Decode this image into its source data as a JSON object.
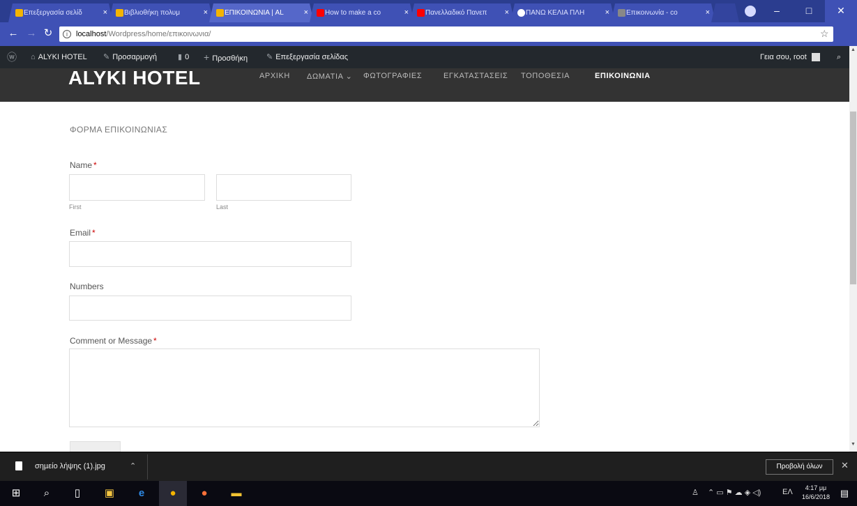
{
  "browser": {
    "tabs": [
      {
        "label": "Επεξεργασία σελίδ",
        "favicon": "#f4b400"
      },
      {
        "label": "Βιβλιοθήκη πολυμ",
        "favicon": "#f4b400"
      },
      {
        "label": "ΕΠΙΚΟΙΝΩΝΙΑ | AL",
        "favicon": "#f4b400",
        "active": true
      },
      {
        "label": "How to make a co",
        "favicon": "#ff0000"
      },
      {
        "label": "Πανελλαδικό Πανεπ",
        "favicon": "#ff0000"
      },
      {
        "label": "ΠΑΝΩ ΚΕΛΙΑ ΠΛΗ",
        "favicon": "#ffffff"
      },
      {
        "label": "Επικοινωνία - co",
        "favicon": "#888888"
      }
    ],
    "url": "localhost/Wordpress/home/επικοινωνια/",
    "url_host": "localhost",
    "url_path": "/Wordpress/home/επικοινωνια/",
    "tab_close": "×",
    "window_controls": {
      "minimize": "–",
      "maximize": "□",
      "close": "✕"
    }
  },
  "adminbar": {
    "site_name": "ALYKI HOTEL",
    "customize": "Προσαρμογή",
    "comments_count": "0",
    "new": "Προσθήκη",
    "edit_page": "Επεξεργασία σελίδας",
    "greeting": "Γεια σου, root"
  },
  "site": {
    "title": "ALYKI HOTEL",
    "menu": [
      "ΑΡΧΙΚΗ",
      "ΔΩΜΑΤΙΑ ⌄",
      "ΦΩΤΟΓΡΑΦΙΕΣ",
      "ΕΓΚΑΤΑΣΤΑΣΕΙΣ",
      "ΤΟΠΟΘΕΣΙΑ",
      "ΕΠΙΚΟΙΝΩΝΙΑ"
    ],
    "current_menu": "ΕΠΙΚΟΙΝΩΝΙΑ"
  },
  "form": {
    "title": "ΦΟΡΜΑ ΕΠΙΚΟΙΝΩΝΙΑΣ",
    "name_label": "Name",
    "first_sublabel": "First",
    "last_sublabel": "Last",
    "email_label": "Email",
    "numbers_label": "Numbers",
    "message_label": "Comment or Message",
    "required_mark": "*",
    "first_value": "",
    "last_value": "",
    "email_value": "",
    "numbers_value": "",
    "message_value": ""
  },
  "downloads": {
    "file_name": "σηµείο λήψης (1).jpg",
    "show_all": "Προβολή όλων",
    "close": "✕"
  },
  "taskbar": {
    "tray_lang": "ΕΛ",
    "time": "4:17 μμ",
    "date": "16/6/2018"
  }
}
